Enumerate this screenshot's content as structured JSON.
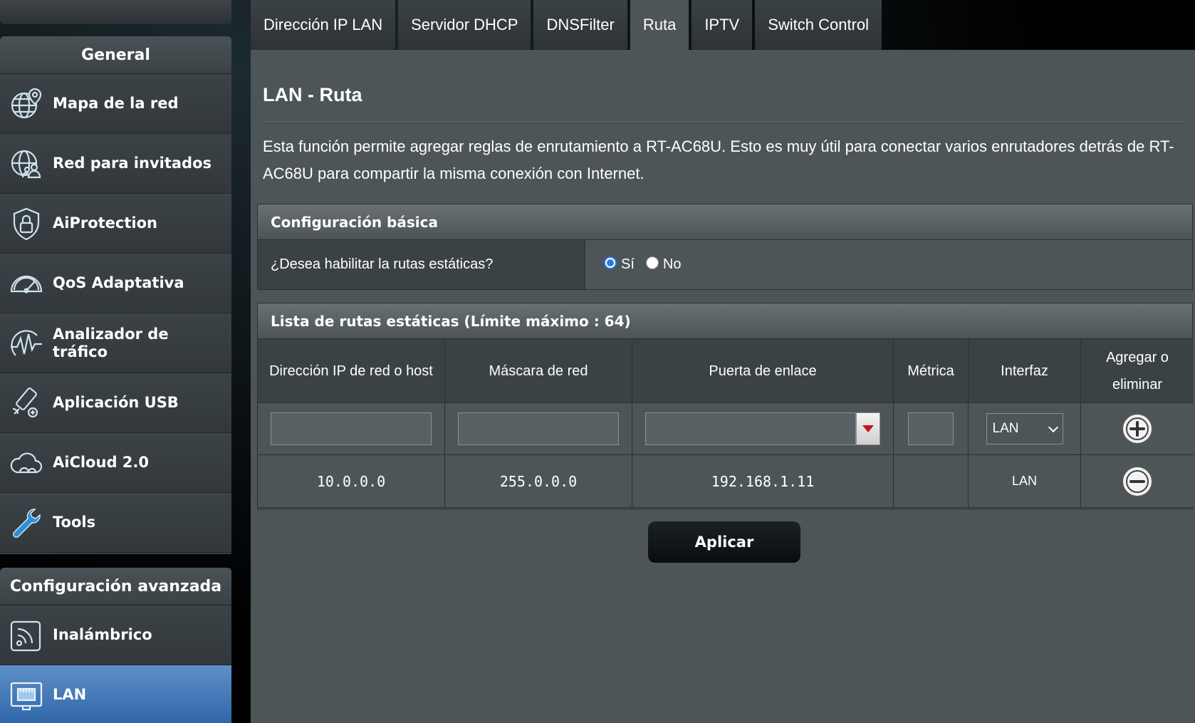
{
  "sidebar": {
    "general_title": "General",
    "general_items": [
      {
        "label": "Mapa de la red",
        "icon": "globe-pin-icon"
      },
      {
        "label": "Red para invitados",
        "icon": "globe-users-icon"
      },
      {
        "label": "AiProtection",
        "icon": "shield-lock-icon"
      },
      {
        "label": "QoS Adaptativa",
        "icon": "speedometer-icon"
      },
      {
        "label": "Analizador de tráfico",
        "icon": "pulse-icon"
      },
      {
        "label": "Aplicación USB",
        "icon": "usb-icon"
      },
      {
        "label": "AiCloud 2.0",
        "icon": "cloud-icon"
      },
      {
        "label": "Tools",
        "icon": "wrench-icon"
      }
    ],
    "advanced_title": "Configuración avanzada",
    "advanced_items": [
      {
        "label": "Inalámbrico",
        "icon": "wireless-icon"
      },
      {
        "label": "LAN",
        "icon": "lan-icon",
        "active": true
      }
    ]
  },
  "tabs": [
    {
      "label": "Dirección IP LAN"
    },
    {
      "label": "Servidor DHCP"
    },
    {
      "label": "DNSFilter"
    },
    {
      "label": "Ruta",
      "active": true
    },
    {
      "label": "IPTV"
    },
    {
      "label": "Switch Control"
    }
  ],
  "page": {
    "title": "LAN - Ruta",
    "description": "Esta función permite agregar reglas de enrutamiento a RT-AC68U. Esto es muy útil para conectar varios enrutadores detrás de RT-AC68U para compartir la misma conexión con Internet."
  },
  "basic": {
    "header": "Configuración básica",
    "question": "¿Desea habilitar la rutas estáticas?",
    "options": [
      "Sí",
      "No"
    ],
    "selected": "Sí"
  },
  "routes": {
    "header": "Lista de rutas estáticas (Límite máximo : 64)",
    "columns": [
      "Dirección IP de red o host",
      "Máscara de red",
      "Puerta de enlace",
      "Métrica",
      "Interfaz",
      "Agregar o eliminar"
    ],
    "new_row": {
      "ip": "",
      "mask": "",
      "gateway": "",
      "metric": "",
      "interface": "LAN"
    },
    "rows": [
      {
        "ip": "10.0.0.0",
        "mask": "255.0.0.0",
        "gateway": "192.168.1.11",
        "metric": "",
        "interface": "LAN"
      }
    ]
  },
  "apply_label": "Aplicar",
  "colors": {
    "panel": "#4d5559",
    "active_menu": "#2f66a8",
    "accent_red": "#c4161c",
    "radio_blue": "#2b7bd6"
  }
}
